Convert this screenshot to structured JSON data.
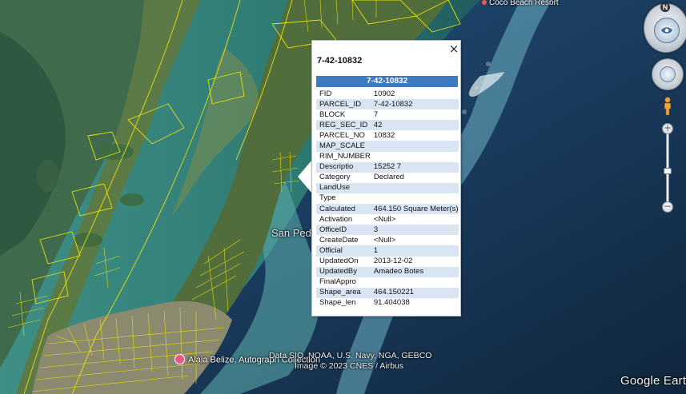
{
  "map": {
    "places": {
      "coco_beach": "Coco Beach Resort",
      "san_pedro": "San Pedro",
      "alaia": "Alaia Belize, Autograph Collection"
    },
    "attribution_line1": "Data SIO, NOAA, U.S. Navy, NGA, GEBCO",
    "attribution_line2": "Image © 2023 CNES / Airbus",
    "brand": "Google Earth",
    "colors": {
      "deep_sea": "#16324d",
      "shallow_water": "#3d8f88",
      "land": "#4f6a3d",
      "parcel_lines": "#f2e600",
      "balloon_header": "#3d7ac2",
      "row_stripe": "#d9e5f3"
    }
  },
  "controls": {
    "north_label": "N",
    "zoom_in_label": "+",
    "zoom_out_label": "−",
    "zoom_level": 0.45,
    "icons": [
      "compass-icon",
      "look-joystick-icon",
      "pegman-icon",
      "zoom-slider"
    ]
  },
  "balloon": {
    "title": "7-42-10832",
    "header": "7-42-10832",
    "close_label": "×",
    "rows": [
      {
        "key": "FID",
        "value": "10902"
      },
      {
        "key": "PARCEL_ID",
        "value": "7-42-10832"
      },
      {
        "key": "BLOCK",
        "value": "7"
      },
      {
        "key": "REG_SEC_ID",
        "value": "42"
      },
      {
        "key": "PARCEL_NO",
        "value": "10832"
      },
      {
        "key": "MAP_SCALE",
        "value": ""
      },
      {
        "key": "RIM_NUMBER",
        "value": ""
      },
      {
        "key": "Descriptio",
        "value": "15252 7"
      },
      {
        "key": "Category",
        "value": "Declared"
      },
      {
        "key": "LandUse",
        "value": ""
      },
      {
        "key": "Type",
        "value": ""
      },
      {
        "key": "Calculated",
        "value": "464.150 Square Meter(s)"
      },
      {
        "key": "Activation",
        "value": "<Null>"
      },
      {
        "key": "OfficeID",
        "value": "3"
      },
      {
        "key": "CreateDate",
        "value": "<Null>"
      },
      {
        "key": "Official",
        "value": "1"
      },
      {
        "key": "UpdatedOn",
        "value": "2013-12-02"
      },
      {
        "key": "UpdatedBy",
        "value": "Amadeo Botes"
      },
      {
        "key": "FinalAppro",
        "value": ""
      },
      {
        "key": "Shape_area",
        "value": "464.150221"
      },
      {
        "key": "Shape_len",
        "value": "91.404038"
      }
    ]
  }
}
